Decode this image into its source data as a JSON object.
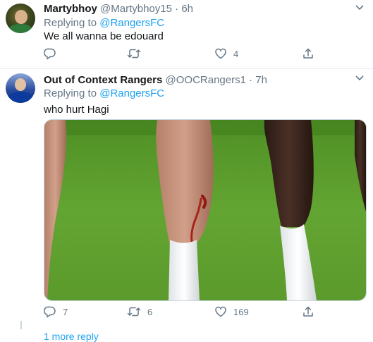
{
  "tweets": [
    {
      "name": "Martybhoy",
      "handle": "@Martybhoy15",
      "separator": "·",
      "time": "6h",
      "replying_prefix": "Replying to ",
      "replying_to": "@RangersFC",
      "text": "We all wanna be edouard",
      "counts": {
        "reply": "",
        "retweet": "",
        "like": "4"
      }
    },
    {
      "name": "Out of Context Rangers",
      "handle": "@OOCRangers1",
      "separator": "·",
      "time": "7h",
      "replying_prefix": "Replying to ",
      "replying_to": "@RangersFC",
      "text": "who hurt Hagi",
      "counts": {
        "reply": "7",
        "retweet": "6",
        "like": "169"
      }
    }
  ],
  "more_replies": "1 more reply",
  "icons": {
    "reply": "reply-icon",
    "retweet": "retweet-icon",
    "like": "heart-icon",
    "share": "share-icon",
    "caret": "chevron-down-icon"
  },
  "colors": {
    "link": "#1da1f2",
    "muted": "#657786",
    "text": "#14171a",
    "grass": "#5f9e2f",
    "blood": "#a8231b"
  }
}
